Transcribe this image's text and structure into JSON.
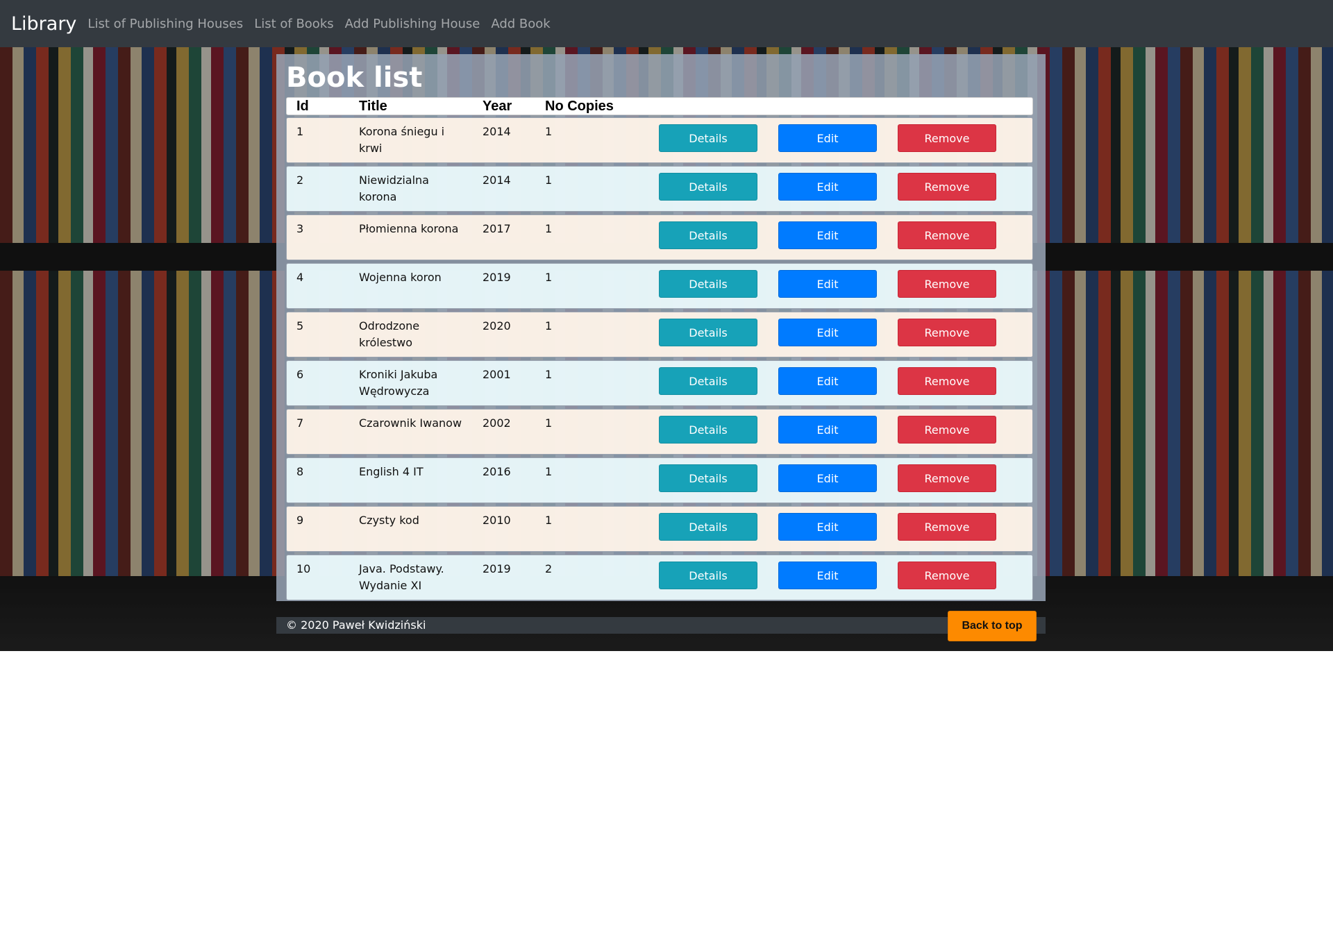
{
  "navbar": {
    "brand": "Library",
    "links": [
      "List of Publishing Houses",
      "List of Books",
      "Add Publishing House",
      "Add Book"
    ]
  },
  "page": {
    "title": "Book list"
  },
  "table": {
    "headers": {
      "id": "Id",
      "title": "Title",
      "year": "Year",
      "copies": "No Copies"
    },
    "rows": [
      {
        "id": "1",
        "title": "Korona śniegu i krwi",
        "year": "2014",
        "copies": "1"
      },
      {
        "id": "2",
        "title": "Niewidzialna korona",
        "year": "2014",
        "copies": "1"
      },
      {
        "id": "3",
        "title": "Płomienna korona",
        "year": "2017",
        "copies": "1"
      },
      {
        "id": "4",
        "title": "Wojenna koron",
        "year": "2019",
        "copies": "1"
      },
      {
        "id": "5",
        "title": "Odrodzone królestwo",
        "year": "2020",
        "copies": "1"
      },
      {
        "id": "6",
        "title": "Kroniki Jakuba Wędrowycza",
        "year": "2001",
        "copies": "1"
      },
      {
        "id": "7",
        "title": "Czarownik Iwanow",
        "year": "2002",
        "copies": "1"
      },
      {
        "id": "8",
        "title": "English 4 IT",
        "year": "2016",
        "copies": "1"
      },
      {
        "id": "9",
        "title": "Czysty kod",
        "year": "2010",
        "copies": "1"
      },
      {
        "id": "10",
        "title": "Java. Podstawy. Wydanie XI",
        "year": "2019",
        "copies": "2"
      }
    ],
    "actions": {
      "details": "Details",
      "edit": "Edit",
      "remove": "Remove"
    }
  },
  "footer": {
    "copyright": "© 2020 Paweł Kwidziński",
    "back_to_top": "Back to top"
  },
  "colors": {
    "navbar_bg": "#343a40",
    "details_btn": "#17a2b8",
    "edit_btn": "#007bff",
    "remove_btn": "#dc3545",
    "back_top_btn": "#fd8a00"
  }
}
